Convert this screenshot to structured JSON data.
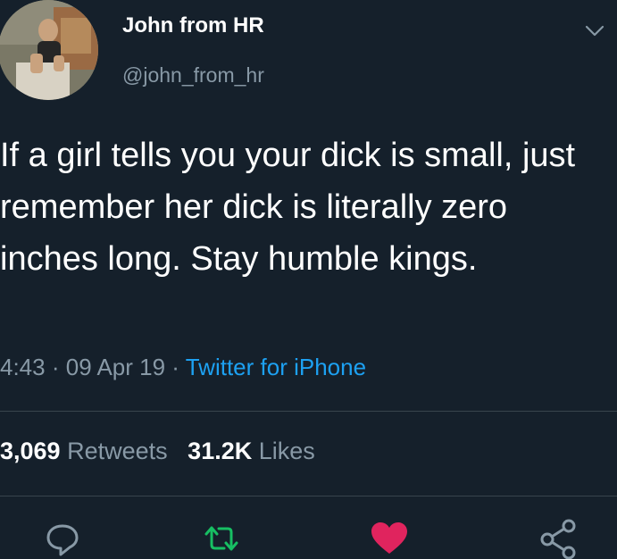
{
  "author": {
    "display_name": "John from HR",
    "handle": "@john_from_hr"
  },
  "tweet": {
    "text": "If a girl tells you your dick is small, just remember her dick is literally zero inches long. Stay humble kings.",
    "time": "4:43",
    "date": "09 Apr 19",
    "separator": "·",
    "source": "Twitter for iPhone"
  },
  "stats": {
    "retweets_count": "3,069",
    "retweets_label": "Retweets",
    "likes_count": "31.2K",
    "likes_label": "Likes"
  },
  "icons": {
    "menu": "chevron-down-icon",
    "reply": "reply-icon",
    "retweet": "retweet-icon",
    "like": "heart-icon",
    "share": "share-icon"
  },
  "colors": {
    "background": "#15202b",
    "secondary_text": "#8899a6",
    "link": "#1da1f2",
    "retweet": "#17bf63",
    "like": "#e0245e",
    "divider": "#38444d"
  }
}
